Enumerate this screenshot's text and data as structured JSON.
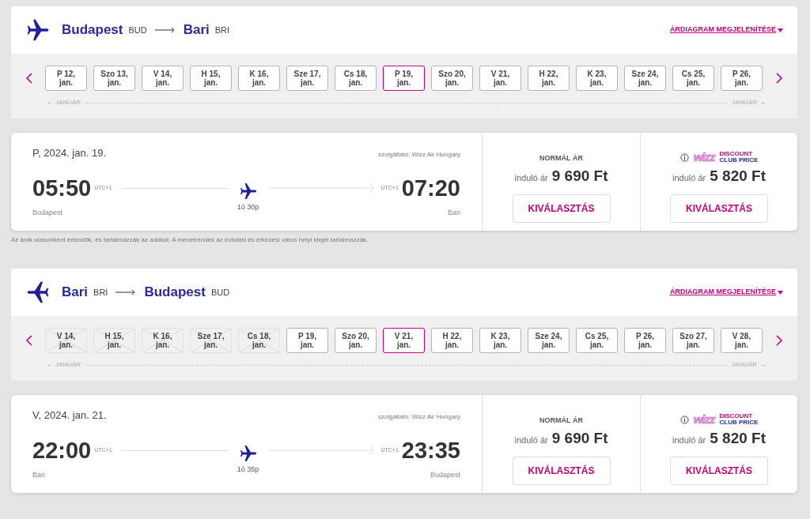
{
  "segments": [
    {
      "from": {
        "city": "Budapest",
        "code": "BUD"
      },
      "to": {
        "city": "Bari",
        "code": "BRI"
      },
      "chart_link": "ÁRDIAGRAM MEGJELENÍTÉSE",
      "dates": [
        {
          "label": "P 12, jan.",
          "selected": false,
          "disabled": false
        },
        {
          "label": "Szo 13, jan.",
          "selected": false,
          "disabled": false
        },
        {
          "label": "V 14, jan.",
          "selected": false,
          "disabled": false
        },
        {
          "label": "H 15, jan.",
          "selected": false,
          "disabled": false
        },
        {
          "label": "K 16, jan.",
          "selected": false,
          "disabled": false
        },
        {
          "label": "Sze 17, jan.",
          "selected": false,
          "disabled": false
        },
        {
          "label": "Cs 18, jan.",
          "selected": false,
          "disabled": false
        },
        {
          "label": "P 19, jan.",
          "selected": true,
          "disabled": false
        },
        {
          "label": "Szo 20, jan.",
          "selected": false,
          "disabled": false
        },
        {
          "label": "V 21, jan.",
          "selected": false,
          "disabled": false
        },
        {
          "label": "H 22, jan.",
          "selected": false,
          "disabled": false
        },
        {
          "label": "K 23, jan.",
          "selected": false,
          "disabled": false
        },
        {
          "label": "Sze 24, jan.",
          "selected": false,
          "disabled": false
        },
        {
          "label": "Cs 25, jan.",
          "selected": false,
          "disabled": false
        },
        {
          "label": "P 26, jan.",
          "selected": false,
          "disabled": false
        }
      ],
      "months": [
        "JANUÁR",
        "JANUÁR"
      ],
      "flight": {
        "date": "P, 2024. jan. 19.",
        "operator": "szolgáltató: Wizz Air Hungary",
        "dep_time": "05:50",
        "dep_tz": "UTC+1",
        "dep_city": "Budapest",
        "duration": "1ó 30p",
        "arr_tz": "UTC+1",
        "arr_time": "07:20",
        "arr_city": "Bari"
      },
      "fares": [
        {
          "kind": "normal",
          "title": "NORMÁL ÁR",
          "from_label": "induló ár",
          "price": "9 690 Ft",
          "button": "KIVÁLASZTÁS"
        },
        {
          "kind": "club",
          "logo": "wizz",
          "title_lines": [
            "DISCOUNT",
            "CLUB PRICE"
          ],
          "from_label": "induló ár",
          "price": "5 820 Ft",
          "button": "KIVÁLASZTÁS"
        }
      ],
      "note": "Az árak utasonként értendők, és tartalmazzák az adókat. A menetrendek az indulási és érkezési város helyi idejét tartalmazzák."
    },
    {
      "from": {
        "city": "Bari",
        "code": "BRI"
      },
      "to": {
        "city": "Budapest",
        "code": "BUD"
      },
      "chart_link": "ÁRDIAGRAM MEGJELENÍTÉSE",
      "dates": [
        {
          "label": "V 14, jan.",
          "selected": false,
          "disabled": true
        },
        {
          "label": "H 15, jan.",
          "selected": false,
          "disabled": true
        },
        {
          "label": "K 16, jan.",
          "selected": false,
          "disabled": true
        },
        {
          "label": "Sze 17, jan.",
          "selected": false,
          "disabled": true
        },
        {
          "label": "Cs 18, jan.",
          "selected": false,
          "disabled": true
        },
        {
          "label": "P 19, jan.",
          "selected": false,
          "disabled": false
        },
        {
          "label": "Szo 20, jan.",
          "selected": false,
          "disabled": false
        },
        {
          "label": "V 21, jan.",
          "selected": true,
          "disabled": false
        },
        {
          "label": "H 22, jan.",
          "selected": false,
          "disabled": false
        },
        {
          "label": "K 23, jan.",
          "selected": false,
          "disabled": false
        },
        {
          "label": "Sze 24, jan.",
          "selected": false,
          "disabled": false
        },
        {
          "label": "Cs 25, jan.",
          "selected": false,
          "disabled": false
        },
        {
          "label": "P 26, jan.",
          "selected": false,
          "disabled": false
        },
        {
          "label": "Szo 27, jan.",
          "selected": false,
          "disabled": false
        },
        {
          "label": "V 28, jan.",
          "selected": false,
          "disabled": false
        }
      ],
      "months": [
        "JANUÁR",
        "JANUÁR"
      ],
      "flight": {
        "date": "V, 2024. jan. 21.",
        "operator": "szolgáltató: Wizz Air Hungary",
        "dep_time": "22:00",
        "dep_tz": "UTC+1",
        "dep_city": "Bari",
        "duration": "1ó 35p",
        "arr_tz": "UTC+1",
        "arr_time": "23:35",
        "arr_city": "Budapest"
      },
      "fares": [
        {
          "kind": "normal",
          "title": "NORMÁL ÁR",
          "from_label": "induló ár",
          "price": "9 690 Ft",
          "button": "KIVÁLASZTÁS"
        },
        {
          "kind": "club",
          "logo": "wizz",
          "title_lines": [
            "DISCOUNT",
            "CLUB PRICE"
          ],
          "from_label": "induló ár",
          "price": "5 820 Ft",
          "button": "KIVÁLASZTÁS"
        }
      ]
    }
  ]
}
